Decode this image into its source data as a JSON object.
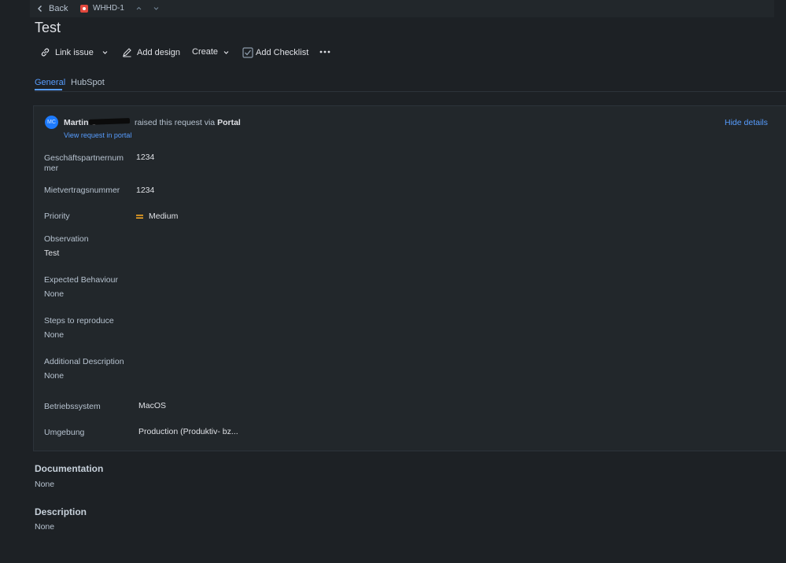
{
  "nav": {
    "back_label": "Back",
    "issue_key": "WHHD-1",
    "issue_icon": "red-square-icon"
  },
  "issue": {
    "title": "Test"
  },
  "toolbar": {
    "link_issue": "Link issue",
    "add_design": "Add design",
    "create": "Create",
    "add_checklist": "Add Checklist"
  },
  "tabs": [
    {
      "label": "General",
      "active": true
    },
    {
      "label": "HubSpot",
      "active": false
    }
  ],
  "request": {
    "avatar_initials": "MC",
    "requester_name": "Martin C",
    "raised_text": "raised this request via",
    "channel": "Portal",
    "view_link": "View request in portal",
    "hide_details": "Hide details"
  },
  "fields": {
    "geschaeftspartnernummer": {
      "label": "Geschäftspartnernum mer",
      "value": "1234"
    },
    "mietvertragsnummer": {
      "label": "Mietvertragsnummer",
      "value": "1234"
    },
    "priority": {
      "label": "Priority",
      "value": "Medium",
      "color": "#f5a623"
    },
    "observation": {
      "label": "Observation",
      "value": "Test"
    },
    "expected_behaviour": {
      "label": "Expected Behaviour",
      "value": "None"
    },
    "steps_to_reproduce": {
      "label": "Steps to reproduce",
      "value": "None"
    },
    "additional_description": {
      "label": "Additional Description",
      "value": "None"
    },
    "betriebssystem": {
      "label": "Betriebssystem",
      "value": "MacOS"
    },
    "umgebung": {
      "label": "Umgebung",
      "value": "Production (Produktiv- bz..."
    }
  },
  "documentation": {
    "heading": "Documentation",
    "value": "None"
  },
  "description": {
    "heading": "Description",
    "value": "None"
  },
  "colors": {
    "accent": "#579dff",
    "background": "#1d2125",
    "panel": "#22272b"
  }
}
